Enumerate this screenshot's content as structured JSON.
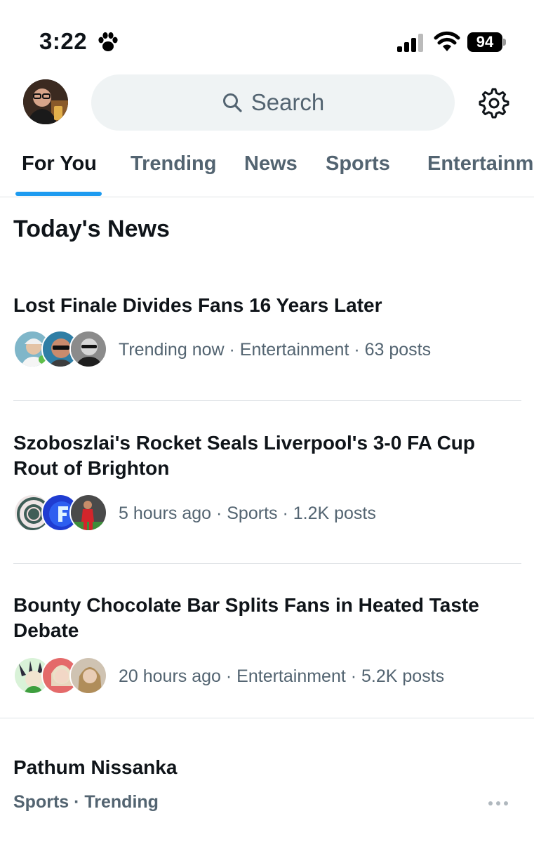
{
  "status_bar": {
    "time": "3:22",
    "battery": "94",
    "icons": [
      "paw-icon",
      "signal-icon",
      "wifi-icon",
      "battery-icon"
    ]
  },
  "header": {
    "search_placeholder": "Search",
    "icons": [
      "avatar",
      "search-icon",
      "gear-icon"
    ]
  },
  "tabs": [
    {
      "label": "For You",
      "active": true
    },
    {
      "label": "Trending",
      "active": false
    },
    {
      "label": "News",
      "active": false
    },
    {
      "label": "Sports",
      "active": false
    },
    {
      "label": "Entertainm",
      "active": false
    }
  ],
  "section_title": "Today's News",
  "news": [
    {
      "headline": "Lost Finale Divides Fans 16 Years Later",
      "meta": "Trending now · Entertainment · 63 posts"
    },
    {
      "headline": "Szoboszlai's Rocket Seals Liverpool's 3-0 FA Cup Rout of Brighton",
      "meta": "5 hours ago · Sports · 1.2K posts"
    },
    {
      "headline": "Bounty Chocolate Bar Splits Fans in Heated Taste Debate",
      "meta": "20 hours ago · Entertainment · 5.2K posts"
    }
  ],
  "trend": {
    "title": "Pathum Nissanka",
    "subtitle": "Sports · Trending"
  },
  "colors": {
    "accent": "#1d9bf0",
    "secondary_text": "#536471",
    "primary_text": "#0f1419",
    "search_bg": "#eff3f4"
  }
}
